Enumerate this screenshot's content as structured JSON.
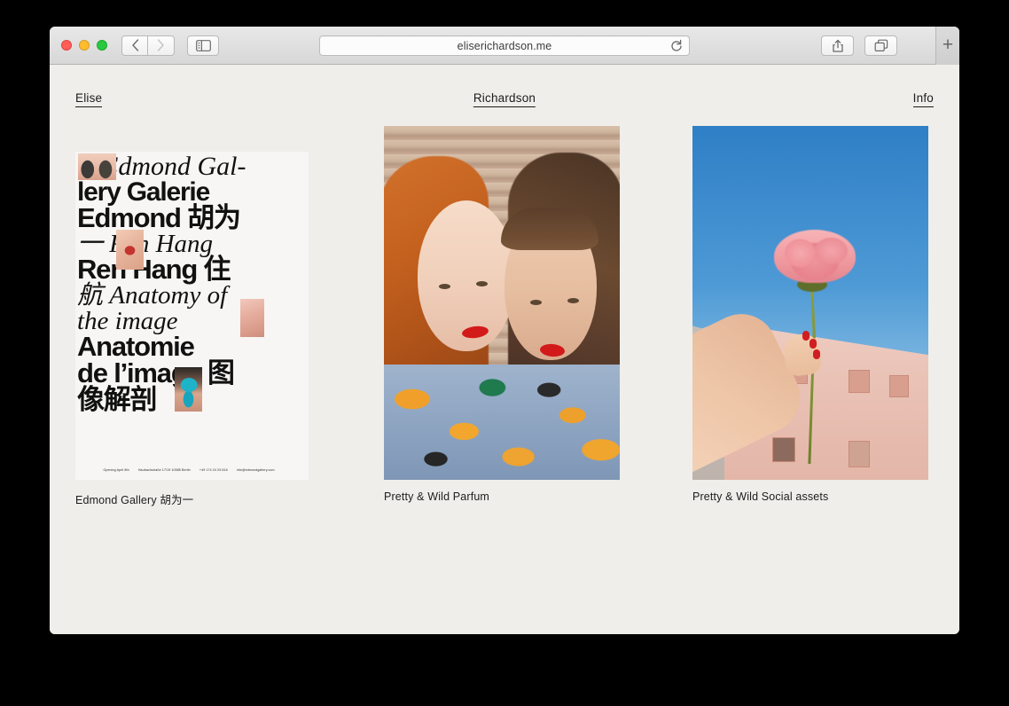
{
  "browser": {
    "traffic_lights": [
      "close",
      "minimize",
      "maximize"
    ],
    "back_label": "‹",
    "forward_label": "›",
    "url": "eliserichardson.me",
    "reload_label": "↻",
    "new_tab_label": "+",
    "colors": {
      "close": "#ff5f57",
      "minimize": "#febc2e",
      "maximize": "#28c840",
      "toolbar": "#e1e0e0"
    }
  },
  "site": {
    "background": "#efeeea",
    "text_color": "#1c1c1c",
    "nav": {
      "left": "Elise",
      "center": "Richardson",
      "right": "Info"
    },
    "projects": [
      {
        "caption": "Edmond Gallery 胡为一",
        "poster": {
          "lines": [
            "Edmond Gal-",
            "lery Galerie",
            "Edmond 胡为",
            "一 Ren Hang",
            "Ren Hang 住",
            "航 Anatomy of",
            "the image",
            "Anatomie",
            "de l’image 图",
            "像解剖"
          ],
          "footer": [
            "Opening April 8th",
            "Haubachstraße 17/19 10585 Berlin",
            "+49 174 24 29 816",
            "info@edmondgallery.com"
          ]
        }
      },
      {
        "caption": "Pretty & Wild Parfum"
      },
      {
        "caption": "Pretty & Wild Social assets"
      }
    ]
  }
}
